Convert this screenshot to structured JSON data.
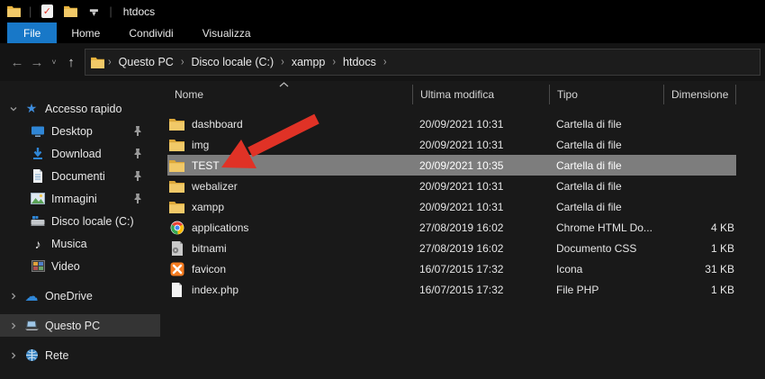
{
  "window": {
    "title": "htdocs",
    "quick_access_toolbar": [
      "app-folder-icon",
      "properties-check-icon",
      "new-folder-icon",
      "customize-dropdown"
    ]
  },
  "ribbon": {
    "tabs": [
      {
        "label": "File",
        "active": true
      },
      {
        "label": "Home",
        "active": false
      },
      {
        "label": "Condividi",
        "active": false
      },
      {
        "label": "Visualizza",
        "active": false
      }
    ]
  },
  "breadcrumb": {
    "segments": [
      "Questo PC",
      "Disco locale (C:)",
      "xampp",
      "htdocs"
    ],
    "trailing_separator": "›"
  },
  "columns": {
    "name": "Nome",
    "modified": "Ultima modifica",
    "type": "Tipo",
    "size": "Dimensione",
    "sorted_by": "Nome",
    "sort_direction": "asc"
  },
  "files": [
    {
      "name": "dashboard",
      "modified": "20/09/2021 10:31",
      "type": "Cartella di file",
      "size": "",
      "icon": "folder",
      "selected": false
    },
    {
      "name": "img",
      "modified": "20/09/2021 10:31",
      "type": "Cartella di file",
      "size": "",
      "icon": "folder",
      "selected": false
    },
    {
      "name": "TEST",
      "modified": "20/09/2021 10:35",
      "type": "Cartella di file",
      "size": "",
      "icon": "folder",
      "selected": true
    },
    {
      "name": "webalizer",
      "modified": "20/09/2021 10:31",
      "type": "Cartella di file",
      "size": "",
      "icon": "folder",
      "selected": false
    },
    {
      "name": "xampp",
      "modified": "20/09/2021 10:31",
      "type": "Cartella di file",
      "size": "",
      "icon": "folder",
      "selected": false
    },
    {
      "name": "applications",
      "modified": "27/08/2019 16:02",
      "type": "Chrome HTML Do...",
      "size": "4 KB",
      "icon": "chrome",
      "selected": false
    },
    {
      "name": "bitnami",
      "modified": "27/08/2019 16:02",
      "type": "Documento CSS",
      "size": "1 KB",
      "icon": "cssfile",
      "selected": false
    },
    {
      "name": "favicon",
      "modified": "16/07/2015 17:32",
      "type": "Icona",
      "size": "31 KB",
      "icon": "xampp",
      "selected": false
    },
    {
      "name": "index.php",
      "modified": "16/07/2015 17:32",
      "type": "File PHP",
      "size": "1 KB",
      "icon": "phpfile",
      "selected": false
    }
  ],
  "sidebar": {
    "items": [
      {
        "label": "Accesso rapido",
        "icon": "star",
        "chevron": "down",
        "level": 1,
        "pinned": false,
        "selected": false
      },
      {
        "label": "Desktop",
        "icon": "desktop",
        "chevron": "none",
        "level": 2,
        "pinned": true,
        "selected": false
      },
      {
        "label": "Download",
        "icon": "download",
        "chevron": "none",
        "level": 2,
        "pinned": true,
        "selected": false
      },
      {
        "label": "Documenti",
        "icon": "document",
        "chevron": "none",
        "level": 2,
        "pinned": true,
        "selected": false
      },
      {
        "label": "Immagini",
        "icon": "image",
        "chevron": "none",
        "level": 2,
        "pinned": true,
        "selected": false
      },
      {
        "label": "Disco locale (C:)",
        "icon": "drive",
        "chevron": "none",
        "level": 2,
        "pinned": false,
        "selected": false
      },
      {
        "label": "Musica",
        "icon": "music",
        "chevron": "none",
        "level": 2,
        "pinned": false,
        "selected": false
      },
      {
        "label": "Video",
        "icon": "video",
        "chevron": "none",
        "level": 2,
        "pinned": false,
        "selected": false
      },
      {
        "label": "OneDrive",
        "icon": "cloud",
        "chevron": "right",
        "level": 1,
        "pinned": false,
        "selected": false,
        "gap_before": true
      },
      {
        "label": "Questo PC",
        "icon": "pc",
        "chevron": "right",
        "level": 1,
        "pinned": false,
        "selected": true,
        "gap_before": true
      },
      {
        "label": "Rete",
        "icon": "network",
        "chevron": "right",
        "level": 1,
        "pinned": false,
        "selected": false,
        "gap_before": true
      }
    ]
  },
  "annotation": {
    "description": "red arrow pointing at TEST folder",
    "color": "#e03226"
  },
  "colors": {
    "accent_tab_blue": "#1878c8",
    "selection_gray": "#7d7d7d",
    "sidebar_selection": "#343434",
    "folder_yellow": "#f1c04f",
    "arrow_red": "#e03226",
    "background": "#191919",
    "titlebar": "#000000"
  }
}
